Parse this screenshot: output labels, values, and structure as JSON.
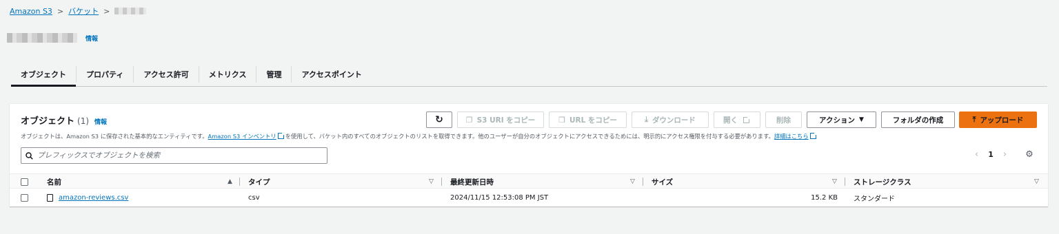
{
  "breadcrumb": {
    "root": "Amazon S3",
    "buckets": "バケット",
    "separator": ">"
  },
  "header": {
    "info": "情報"
  },
  "tabs": [
    {
      "label": "オブジェクト"
    },
    {
      "label": "プロパティ"
    },
    {
      "label": "アクセス許可"
    },
    {
      "label": "メトリクス"
    },
    {
      "label": "管理"
    },
    {
      "label": "アクセスポイント"
    }
  ],
  "objects_panel": {
    "title": "オブジェクト",
    "count": "(1)",
    "info": "情報",
    "desc_prefix": "オブジェクトは、Amazon S3 に保存された基本的なエンティティです。",
    "inventory_link": "Amazon S3 インベントリ",
    "desc_middle": "を使用して、バケット内のすべてのオブジェクトのリストを取得できます。他のユーザーが自分のオブジェクトにアクセスできるためには、明示的にアクセス権限を付与する必要があります。",
    "details_link": "詳細はこちら"
  },
  "toolbar": {
    "refresh_glyph": "↻",
    "copy_s3_uri": "S3 URI をコピー",
    "copy_url": "URL をコピー",
    "download": "ダウンロード",
    "open": "開く",
    "delete": "削除",
    "actions": "アクション",
    "create_folder": "フォルダの作成",
    "upload": "アップロード"
  },
  "search": {
    "placeholder": "プレフィックスでオブジェクトを検索"
  },
  "pagination": {
    "page": "1",
    "prev": "‹",
    "next": "›"
  },
  "table": {
    "columns": {
      "name": "名前",
      "type": "タイプ",
      "last_modified": "最終更新日時",
      "size": "サイズ",
      "storage_class": "ストレージクラス"
    },
    "rows": [
      {
        "name": "amazon-reviews.csv",
        "type": "csv",
        "last_modified": "2024/11/15 12:53:08 PM JST",
        "size": "15.2 KB",
        "storage_class": "スタンダード"
      }
    ]
  },
  "colors": {
    "link": "#0073bb",
    "primary": "#ec7211",
    "background": "#f2f3f3"
  },
  "icons": {
    "refresh": "refresh-icon",
    "copy": "copy-icon",
    "download": "download-icon",
    "external": "external-link-icon",
    "caret": "caret-down-icon",
    "upload": "upload-icon",
    "search": "search-icon",
    "settings": "gear-icon",
    "file": "file-icon"
  }
}
